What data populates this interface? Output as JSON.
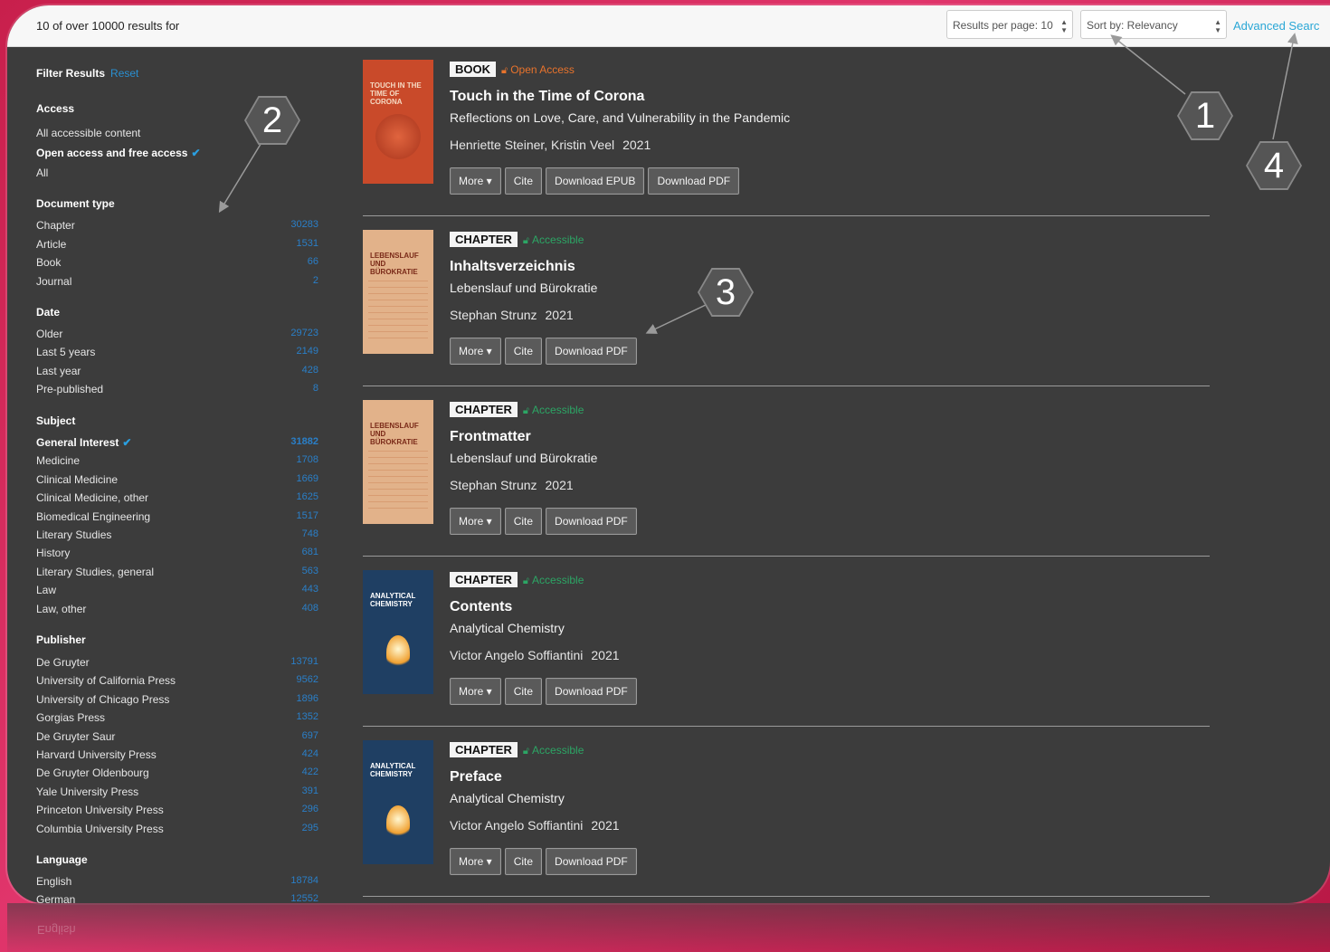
{
  "topbar": {
    "result_count": "10 of over 10000 results for",
    "per_page": "Results per page: 10",
    "sort": "Sort by: Relevancy",
    "advanced_search": "Advanced Searc"
  },
  "sidebar": {
    "filter_title": "Filter Results",
    "reset": "Reset",
    "access_title": "Access",
    "access": [
      {
        "label": "All accessible content",
        "active": false
      },
      {
        "label": "Open access and free access",
        "active": true
      },
      {
        "label": "All",
        "active": false
      }
    ],
    "doctype_title": "Document type",
    "doctype": [
      {
        "label": "Chapter",
        "count": "30283"
      },
      {
        "label": "Article",
        "count": "1531"
      },
      {
        "label": "Book",
        "count": "66"
      },
      {
        "label": "Journal",
        "count": "2"
      }
    ],
    "date_title": "Date",
    "date": [
      {
        "label": "Older",
        "count": "29723"
      },
      {
        "label": "Last 5 years",
        "count": "2149"
      },
      {
        "label": "Last year",
        "count": "428"
      },
      {
        "label": "Pre-published",
        "count": "8"
      }
    ],
    "subject_title": "Subject",
    "subject": [
      {
        "label": "General Interest",
        "count": "31882",
        "active": true
      },
      {
        "label": "Medicine",
        "count": "1708"
      },
      {
        "label": "Clinical Medicine",
        "count": "1669"
      },
      {
        "label": "Clinical Medicine, other",
        "count": "1625"
      },
      {
        "label": "Biomedical Engineering",
        "count": "1517"
      },
      {
        "label": "Literary Studies",
        "count": "748"
      },
      {
        "label": "History",
        "count": "681"
      },
      {
        "label": "Literary Studies, general",
        "count": "563"
      },
      {
        "label": "Law",
        "count": "443"
      },
      {
        "label": "Law, other",
        "count": "408"
      }
    ],
    "publisher_title": "Publisher",
    "publisher": [
      {
        "label": "De Gruyter",
        "count": "13791"
      },
      {
        "label": "University of California Press",
        "count": "9562"
      },
      {
        "label": "University of Chicago Press",
        "count": "1896"
      },
      {
        "label": "Gorgias Press",
        "count": "1352"
      },
      {
        "label": "De Gruyter Saur",
        "count": "697"
      },
      {
        "label": "Harvard University Press",
        "count": "424"
      },
      {
        "label": "De Gruyter Oldenbourg",
        "count": "422"
      },
      {
        "label": "Yale University Press",
        "count": "391"
      },
      {
        "label": "Princeton University Press",
        "count": "296"
      },
      {
        "label": "Columbia University Press",
        "count": "295"
      }
    ],
    "language_title": "Language",
    "language": [
      {
        "label": "English",
        "count": "18784"
      },
      {
        "label": "German",
        "count": "12552"
      }
    ]
  },
  "results": [
    {
      "type": "BOOK",
      "access": "Open Access",
      "access_kind": "open",
      "title": "Touch in the Time of Corona",
      "subtitle": "Reflections on Love, Care, and Vulnerability in the Pandemic",
      "authors": "Henriette Steiner, Kristin Veel",
      "year": "2021",
      "cover_text": "TOUCH IN THE TIME OF CORONA",
      "cover_color": "#c94a2a",
      "buttons": [
        "More ▾",
        "Cite",
        "Download EPUB",
        "Download PDF"
      ]
    },
    {
      "type": "CHAPTER",
      "access": "Accessible",
      "access_kind": "acc",
      "title": "Inhaltsverzeichnis",
      "subtitle": "Lebenslauf und Bürokratie",
      "authors": "Stephan Strunz",
      "year": "2021",
      "cover_text": "LEBENSLAUF UND BÜROKRATIE",
      "cover_color": "#e2b28a",
      "buttons": [
        "More ▾",
        "Cite",
        "Download PDF"
      ]
    },
    {
      "type": "CHAPTER",
      "access": "Accessible",
      "access_kind": "acc",
      "title": "Frontmatter",
      "subtitle": "Lebenslauf und Bürokratie",
      "authors": "Stephan Strunz",
      "year": "2021",
      "cover_text": "LEBENSLAUF UND BÜROKRATIE",
      "cover_color": "#e2b28a",
      "buttons": [
        "More ▾",
        "Cite",
        "Download PDF"
      ]
    },
    {
      "type": "CHAPTER",
      "access": "Accessible",
      "access_kind": "acc",
      "title": "Contents",
      "subtitle": "Analytical Chemistry",
      "authors": "Victor Angelo Soffiantini",
      "year": "2021",
      "cover_text": "ANALYTICAL CHEMISTRY",
      "cover_color": "#1f3f63",
      "buttons": [
        "More ▾",
        "Cite",
        "Download PDF"
      ]
    },
    {
      "type": "CHAPTER",
      "access": "Accessible",
      "access_kind": "acc",
      "title": "Preface",
      "subtitle": "Analytical Chemistry",
      "authors": "Victor Angelo Soffiantini",
      "year": "2021",
      "cover_text": "ANALYTICAL CHEMISTRY",
      "cover_color": "#1f3f63",
      "buttons": [
        "More ▾",
        "Cite",
        "Download PDF"
      ]
    }
  ],
  "markers": [
    "1",
    "2",
    "3",
    "4"
  ],
  "colors": {
    "accent": "#2aa7d6",
    "open_access": "#e8732c",
    "accessible": "#2ca665",
    "background": "#3c3c3c"
  }
}
